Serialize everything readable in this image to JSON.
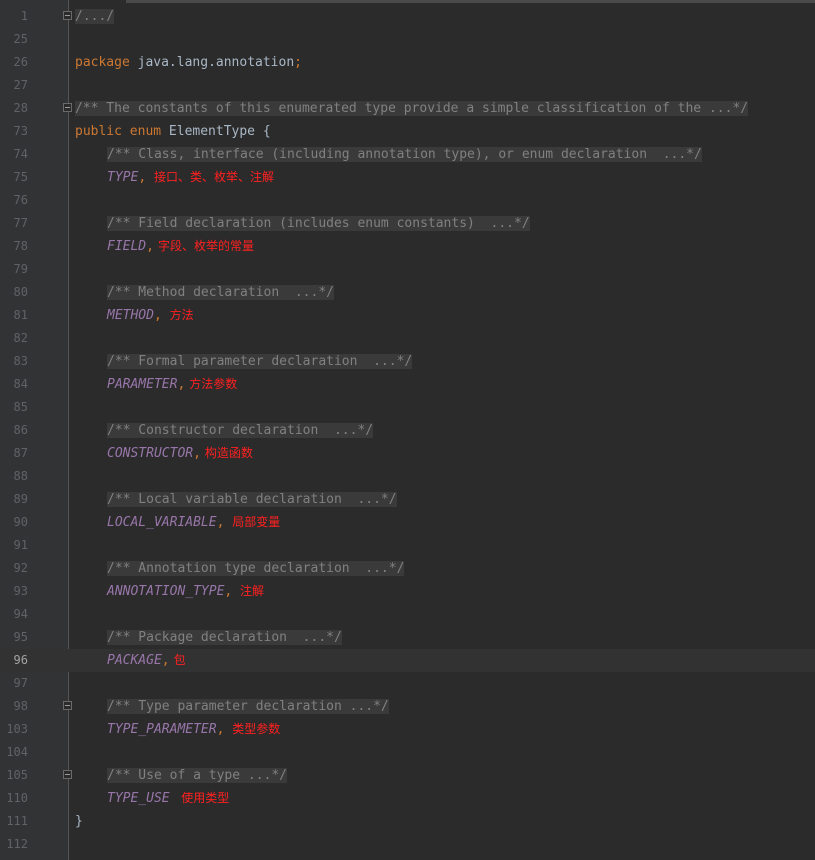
{
  "editor": {
    "current_line": "96",
    "lines": [
      {
        "num": "1",
        "fold": true,
        "comment": "/.../"
      },
      {
        "num": "25"
      },
      {
        "num": "26",
        "keyword": "package",
        "text": " java.lang.annotation",
        "punct": ";"
      },
      {
        "num": "27"
      },
      {
        "num": "28",
        "fold": true,
        "comment": "/** The constants of this enumerated type provide a simple classification of the ...*/"
      },
      {
        "num": "73",
        "keyword": "public enum",
        "text": " ElementType {"
      },
      {
        "num": "74",
        "comment": "/** Class, interface (including annotation type), or enum declaration  ...*/"
      },
      {
        "num": "75",
        "constant": "TYPE",
        "punct": ",",
        "note": " 接口、类、枚举、注解"
      },
      {
        "num": "76"
      },
      {
        "num": "77",
        "comment": "/** Field declaration (includes enum constants)  ...*/"
      },
      {
        "num": "78",
        "constant": "FIELD",
        "punct": ",",
        "note": "字段、枚举的常量"
      },
      {
        "num": "79"
      },
      {
        "num": "80",
        "comment": "/** Method declaration  ...*/"
      },
      {
        "num": "81",
        "constant": "METHOD",
        "punct": ",",
        "note": " 方法"
      },
      {
        "num": "82"
      },
      {
        "num": "83",
        "comment": "/** Formal parameter declaration  ...*/"
      },
      {
        "num": "84",
        "constant": "PARAMETER",
        "punct": ",",
        "note": "方法参数"
      },
      {
        "num": "85"
      },
      {
        "num": "86",
        "comment": "/** Constructor declaration  ...*/"
      },
      {
        "num": "87",
        "constant": "CONSTRUCTOR",
        "punct": ",",
        "note": "构造函数"
      },
      {
        "num": "88"
      },
      {
        "num": "89",
        "comment": "/** Local variable declaration  ...*/"
      },
      {
        "num": "90",
        "constant": "LOCAL_VARIABLE",
        "punct": ",",
        "note": " 局部变量"
      },
      {
        "num": "91"
      },
      {
        "num": "92",
        "comment": "/** Annotation type declaration  ...*/"
      },
      {
        "num": "93",
        "constant": "ANNOTATION_TYPE",
        "punct": ",",
        "note": " 注解"
      },
      {
        "num": "94"
      },
      {
        "num": "95",
        "comment": "/** Package declaration  ...*/"
      },
      {
        "num": "96",
        "constant": "PACKAGE",
        "punct": ",",
        "note": "包"
      },
      {
        "num": "97"
      },
      {
        "num": "98",
        "fold": true,
        "comment": "/** Type parameter declaration ...*/"
      },
      {
        "num": "103",
        "constant": "TYPE_PARAMETER",
        "punct": ",",
        "note": " 类型参数"
      },
      {
        "num": "104"
      },
      {
        "num": "105",
        "fold": true,
        "comment": "/** Use of a type ...*/"
      },
      {
        "num": "110",
        "constant": "TYPE_USE",
        "note": "  使用类型"
      },
      {
        "num": "111",
        "text": "}"
      },
      {
        "num": "112"
      }
    ]
  }
}
